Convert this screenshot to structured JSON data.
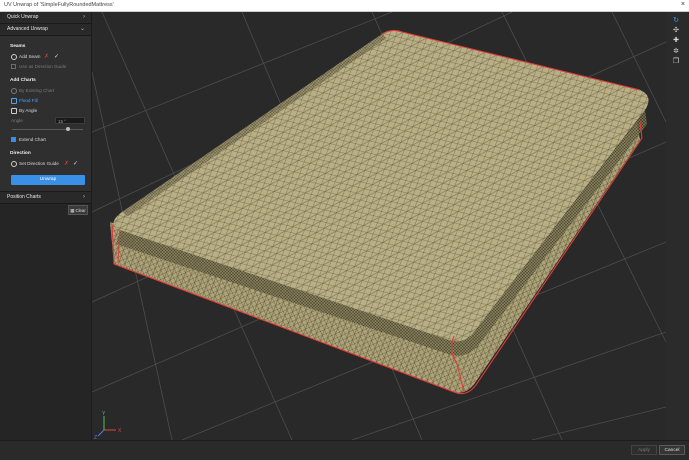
{
  "window": {
    "title": "UV Unwrap of 'SimpleFullyRoundedMattress'",
    "close_glyph": "×"
  },
  "panel": {
    "quick_unwrap": "Quick Unwrap",
    "advanced_unwrap": "Advanced Unwrap",
    "seams": {
      "heading": "Seams",
      "add_seam": "Add Seam",
      "use_direction_guide": "Use as Direction Guide"
    },
    "add_charts": {
      "heading": "Add Charts",
      "by_existing_chart": "By Existing Chart",
      "flood_fill": "Flood Fill",
      "by_angle": "By Angle",
      "angle_label": "Angle",
      "angle_value": "15 °",
      "angle_fraction": 0.8,
      "extend_chart": "Extend Chart"
    },
    "direction": {
      "heading": "Direction",
      "set_direction_guide": "Set Direction Guide"
    },
    "unwrap_button": "Unwrap",
    "position_charts": "Position Charts",
    "clear_button": "Clear"
  },
  "footer": {
    "apply": "Apply",
    "cancel": "Cancel"
  },
  "colors": {
    "accent": "#3a8fe6",
    "seam": "#e23b3b",
    "mesh_fill": "#b7ad85",
    "mesh_line": "#6d6644"
  },
  "axis_labels": {
    "x": "X",
    "y": "Y",
    "z": "Z"
  },
  "icons": [
    "refresh-icon",
    "fit-view-icon",
    "pin-icon",
    "settings-icon",
    "layers-icon"
  ]
}
